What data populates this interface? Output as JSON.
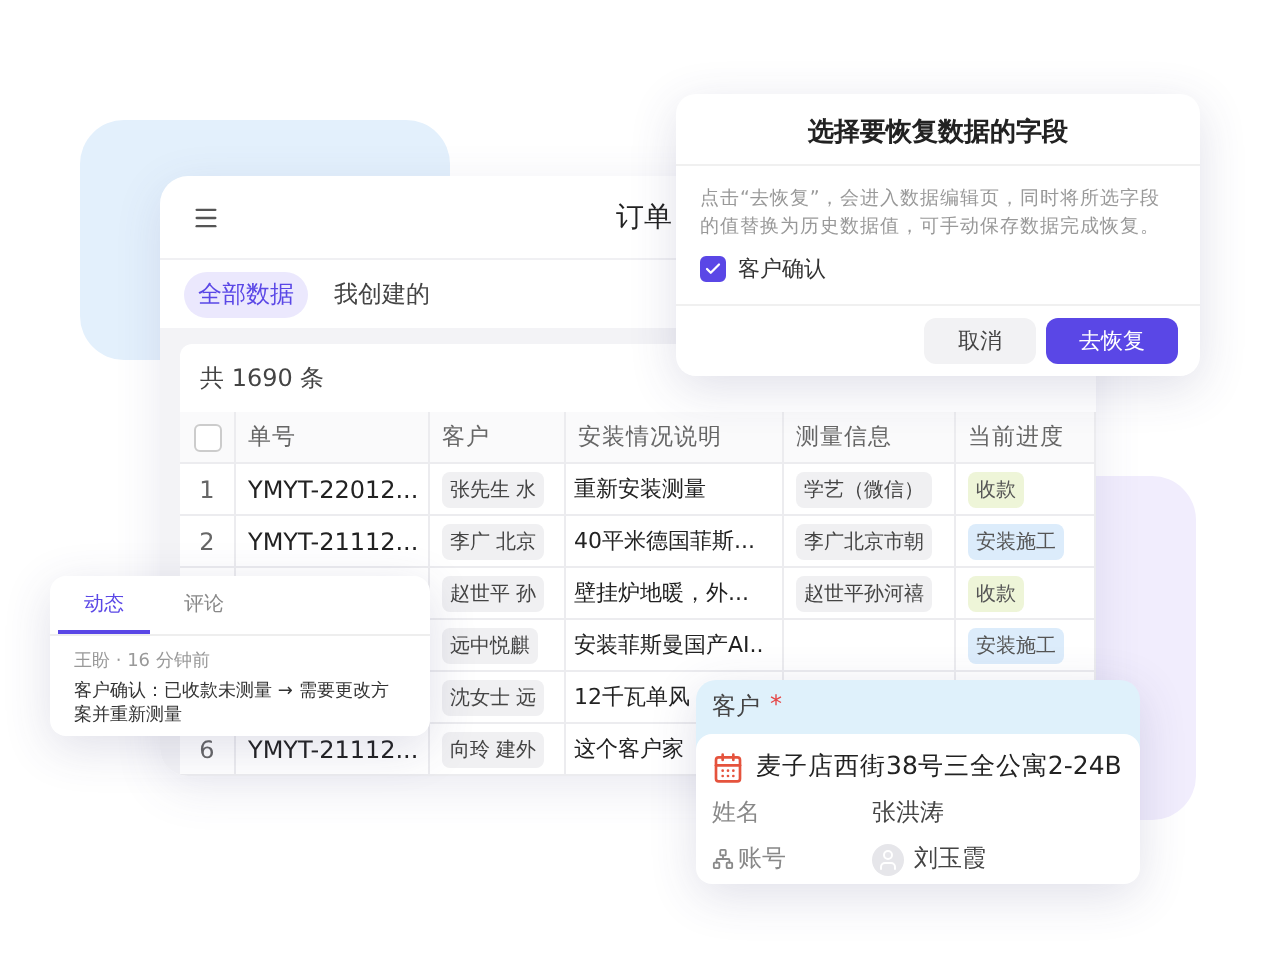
{
  "app": {
    "title": "订单",
    "tabs": [
      {
        "label": "全部数据",
        "selected": true
      },
      {
        "label": "我创建的",
        "selected": false
      }
    ]
  },
  "table": {
    "count": "共 1690 条",
    "select_all": {
      "checked": false
    },
    "columns": [
      "单号",
      "客户",
      "安装情况说明",
      "测量信息",
      "当前进度"
    ],
    "rows": [
      {
        "index": "1",
        "order": "YMYT-22012...",
        "customer": "张先生 水",
        "note": "重新安装测量",
        "measure": "学艺（微信）",
        "progress": {
          "label": "收款",
          "color": "#eef5d8"
        }
      },
      {
        "index": "2",
        "order": "YMYT-21112...",
        "customer": "李广 北京",
        "note": "40平米德国菲斯...",
        "measure": "李广北京市朝",
        "progress": {
          "label": "安装施工",
          "color": "#dcecfb"
        }
      },
      {
        "customer": "赵世平 孙",
        "note": "壁挂炉地暖，外...",
        "measure": "赵世平孙河禧",
        "progress": {
          "label": "收款",
          "color": "#eef5d8"
        }
      },
      {
        "customer": "远中悦麒",
        "note": "安装菲斯曼国产AI..",
        "progress": {
          "label": "安装施工",
          "color": "#dcecfb"
        }
      },
      {
        "customer": "沈女士 远",
        "note": "12千瓦单风"
      },
      {
        "index": "6",
        "order": "YMYT-21112...",
        "customer": "向玲 建外",
        "note": "这个客户家"
      }
    ]
  },
  "dialog": {
    "title": "选择要恢复数据的字段",
    "description": "点击“去恢复”，会进入数据编辑页，同时将所选字段的值替换为历史数据值，可手动保存数据完成恢复。",
    "option": {
      "label": "客户确认",
      "checked": true
    },
    "buttons": [
      {
        "label": "取消",
        "kind": "secondary"
      },
      {
        "label": "去恢复",
        "kind": "primary"
      }
    ]
  },
  "activity": {
    "tabs": [
      {
        "label": "动态",
        "selected": true
      },
      {
        "label": "评论",
        "selected": false
      }
    ],
    "meta": "王盼 · 16 分钟前",
    "text": "客户确认：已收款未测量 → 需要更改方案并重新测量"
  },
  "customer_card": {
    "label": "客户",
    "required": "*",
    "address": "麦子店西街38号三全公寓2-24B",
    "fields": [
      {
        "label": "姓名",
        "value": "张洪涛",
        "kind": "plain"
      },
      {
        "label": "账号",
        "value": "刘玉霞",
        "kind": "account"
      }
    ]
  }
}
